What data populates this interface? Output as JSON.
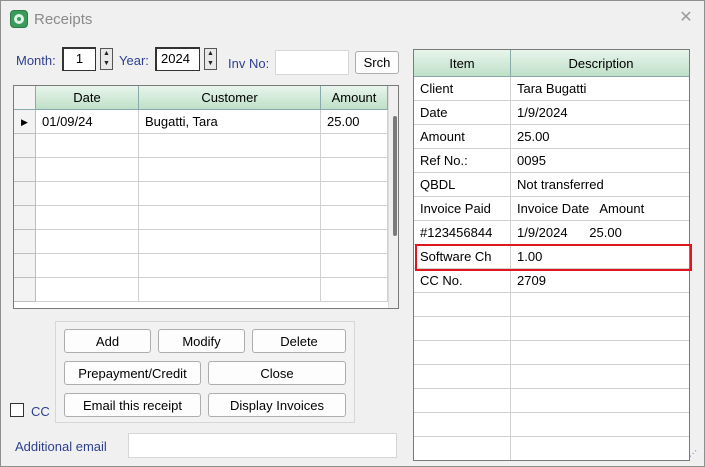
{
  "window": {
    "title": "Receipts"
  },
  "filters": {
    "month_label": "Month:",
    "month_value": "1",
    "year_label": "Year:",
    "year_value": "2024",
    "inv_no_label": "Inv No:",
    "inv_no_value": "",
    "search_button": "Srch"
  },
  "receipts_table": {
    "columns": [
      "Date",
      "Customer",
      "Amount"
    ],
    "rows": [
      {
        "date": "01/09/24",
        "customer": "Bugatti, Tara",
        "amount": "25.00"
      }
    ],
    "selected_row_marker": "▶"
  },
  "details_table": {
    "columns": [
      "Item",
      "Description"
    ],
    "rows": [
      {
        "item": "Client",
        "description": "Tara Bugatti"
      },
      {
        "item": "Date",
        "description": "1/9/2024"
      },
      {
        "item": "Amount",
        "description": "25.00"
      },
      {
        "item": "Ref No.:",
        "description": "0095"
      },
      {
        "item": "QBDL",
        "description": "Not transferred"
      },
      {
        "item": "Invoice Paid",
        "description": "Invoice Date   Amount"
      },
      {
        "item": "#123456844",
        "description": "1/9/2024      25.00"
      },
      {
        "item": "Software Ch",
        "description": "1.00"
      },
      {
        "item": "CC No.",
        "description": "2709"
      }
    ],
    "highlight_color": "#e0161e"
  },
  "buttons": {
    "add": "Add",
    "modify": "Modify",
    "delete": "Delete",
    "prepayment_credit": "Prepayment/Credit",
    "close": "Close",
    "email_receipt": "Email this receipt",
    "display_invoices": "Display Invoices"
  },
  "cc_checkbox": {
    "label": "CC",
    "checked": false
  },
  "additional_email": {
    "label": "Additional email",
    "value": ""
  },
  "colors": {
    "header_green": "#cfe8d6",
    "label_blue": "#2d3f8f"
  }
}
